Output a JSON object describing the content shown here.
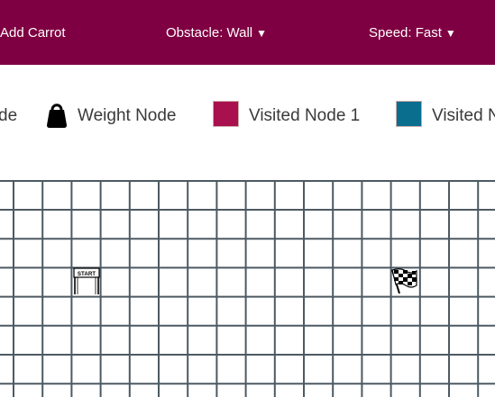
{
  "topbar": {
    "add_carrot_label": "Add Carrot",
    "obstacle_label": "Obstacle: Wall",
    "speed_label": "Speed: Fast",
    "caret_glyph": "▼",
    "background": "#7f0042"
  },
  "legend": {
    "partial_label": "de",
    "weight_node_label": "Weight Node",
    "visited_node_1_label": "Visited Node 1",
    "visited_node_2_partial_label": "Visited N",
    "visited_node_1_color": "#a8114e",
    "visited_node_2_color": "#0a6e8f"
  },
  "grid": {
    "start_badge_text": "START",
    "line_color": "#4d5a63"
  }
}
